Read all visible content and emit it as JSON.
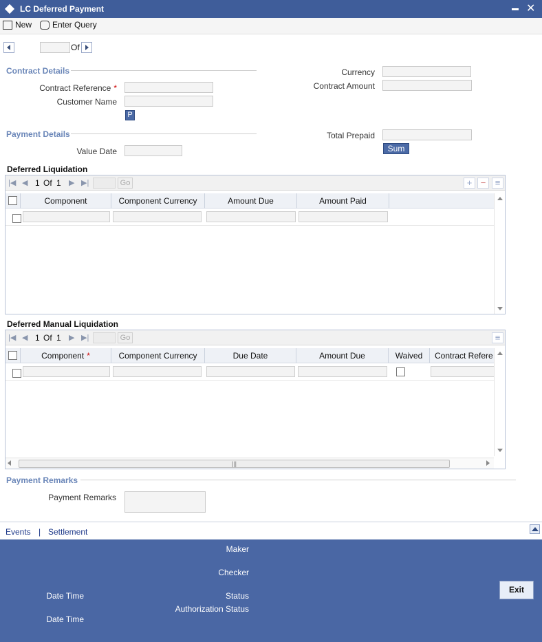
{
  "window": {
    "title": "LC Deferred Payment"
  },
  "toolbar": {
    "new_label": "New",
    "enter_query_label": "Enter Query"
  },
  "nav": {
    "of_label": "Of"
  },
  "contract_details": {
    "heading": "Contract Details",
    "contract_reference_label": "Contract Reference",
    "customer_name_label": "Customer Name",
    "p_button": "P",
    "currency_label": "Currency",
    "contract_amount_label": "Contract Amount"
  },
  "payment_details": {
    "heading": "Payment Details",
    "value_date_label": "Value Date",
    "total_prepaid_label": "Total Prepaid",
    "sum_button": "Sum"
  },
  "deferred_liquidation": {
    "heading": "Deferred Liquidation",
    "page_current": "1",
    "page_of": "Of",
    "page_total": "1",
    "go": "Go",
    "columns": [
      "Component",
      "Component Currency",
      "Amount Due",
      "Amount Paid"
    ]
  },
  "deferred_manual_liquidation": {
    "heading": "Deferred Manual Liquidation",
    "page_current": "1",
    "page_of": "Of",
    "page_total": "1",
    "go": "Go",
    "columns": [
      "Component",
      "Component Currency",
      "Due Date",
      "Amount Due",
      "Waived",
      "Contract Refere"
    ]
  },
  "payment_remarks": {
    "heading": "Payment Remarks",
    "label": "Payment Remarks"
  },
  "links": {
    "events": "Events",
    "separator": "|",
    "settlement": "Settlement"
  },
  "footer": {
    "maker": "Maker",
    "checker": "Checker",
    "date_time_1": "Date Time",
    "status": "Status",
    "authorization_status": "Authorization Status",
    "date_time_2": "Date Time",
    "exit": "Exit"
  },
  "colors": {
    "title_bar": "#3f5d9a",
    "footer": "#4a67a4",
    "section_heading": "#6a86b8",
    "required": "#cc0000"
  }
}
